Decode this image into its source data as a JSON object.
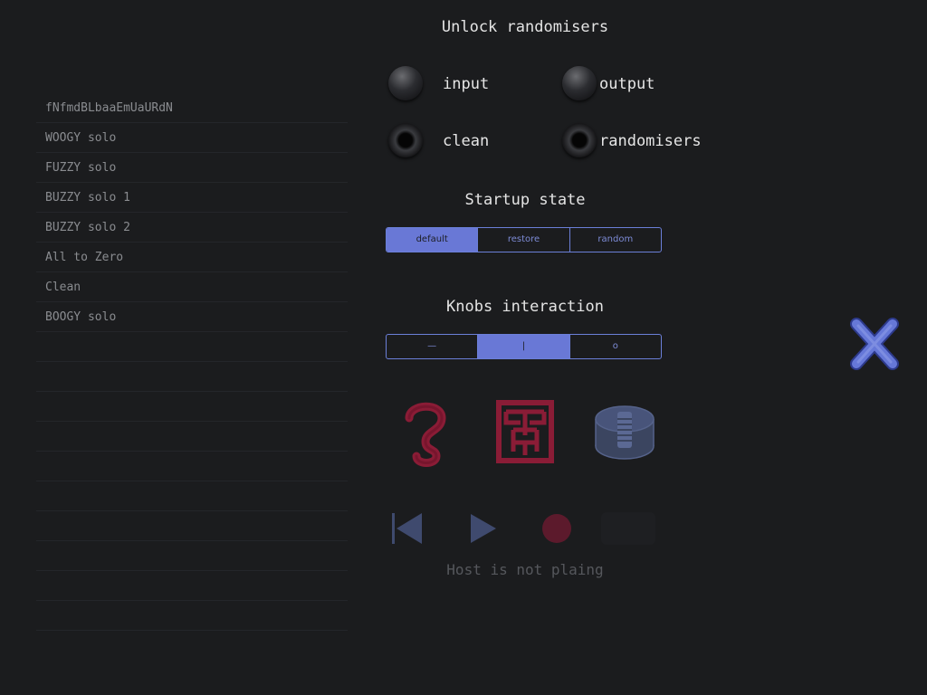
{
  "presets": [
    "fNfmdBLbaaEmUaURdN",
    "WOOGY solo",
    "FUZZY solo",
    "BUZZY solo 1",
    "BUZZY solo 2",
    "All to Zero",
    "Clean",
    "BOOGY solo",
    "",
    "",
    "",
    "",
    "",
    "",
    "",
    "",
    "",
    ""
  ],
  "unlock": {
    "title": "Unlock randomisers",
    "input": "input",
    "output": "output",
    "clean": "clean",
    "randomisers": "randomisers"
  },
  "startup": {
    "title": "Startup state",
    "options": [
      "default",
      "restore",
      "random"
    ],
    "selected": "default"
  },
  "knobs": {
    "title": "Knobs interaction",
    "options": [
      "—",
      "|",
      "o"
    ],
    "selected": "|"
  },
  "transport": {
    "status": "Host is not plaing"
  },
  "colors": {
    "accent": "#6978d6",
    "crimson": "#8a1c36",
    "background": "#1b1c1e"
  }
}
